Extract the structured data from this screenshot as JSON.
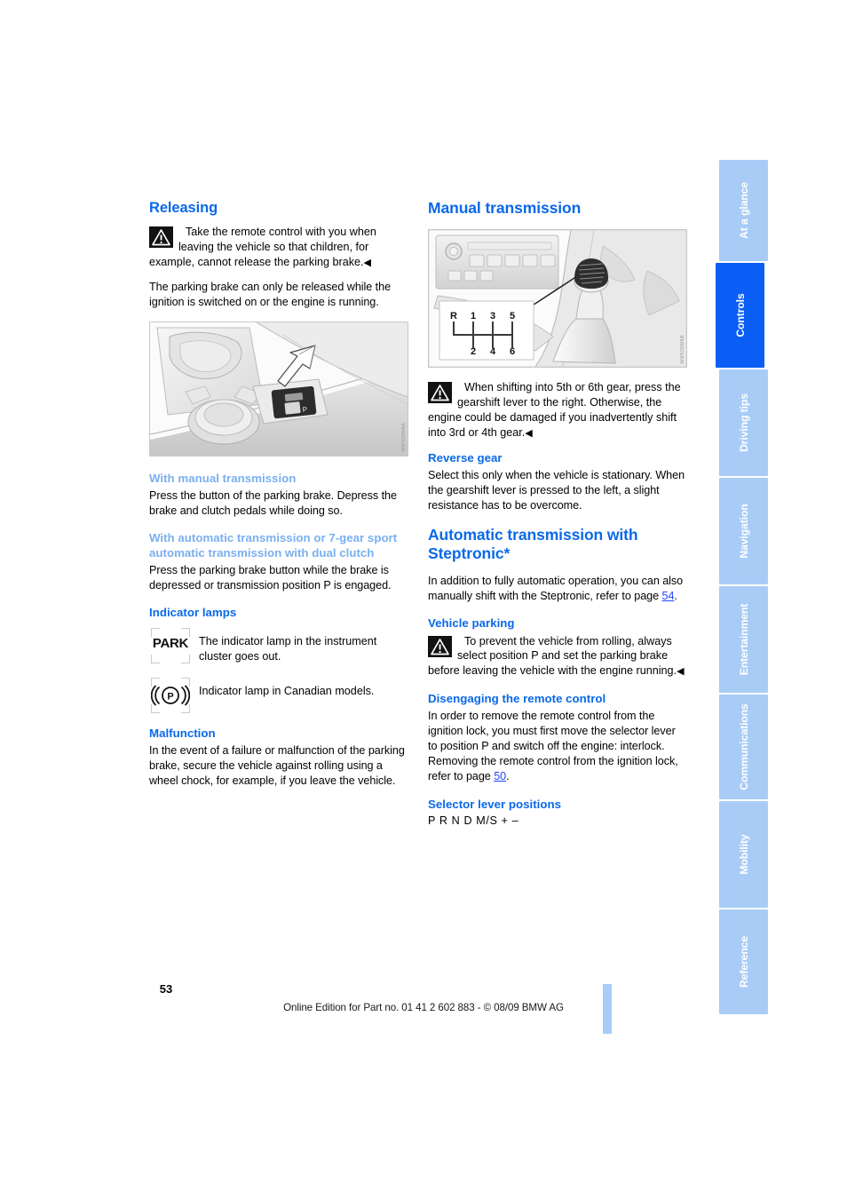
{
  "left_column": {
    "releasing": {
      "heading": "Releasing",
      "warning": "Take the remote control with you when leaving the vehicle so that children, for example, cannot release the parking brake.",
      "body": "The parking brake can only be released while the ignition is switched on or the engine is running."
    },
    "figure_console": {
      "code": "WW52DMAA"
    },
    "with_manual": {
      "heading": "With manual transmission",
      "body": "Press the button of the parking brake. Depress the brake and clutch pedals while doing so."
    },
    "with_automatic": {
      "heading": "With automatic transmission or 7-gear sport automatic transmission with dual clutch",
      "body": "Press the parking brake button while the brake is depressed or transmission position P is engaged."
    },
    "indicator_lamps": {
      "heading": "Indicator lamps",
      "items": [
        {
          "icon": "park-lamp-icon",
          "icon_label": "PARK",
          "text": "The indicator lamp in the instrument cluster goes out."
        },
        {
          "icon": "p-circle-lamp-icon",
          "icon_label": "((P))",
          "text": "Indicator lamp in Canadian models."
        }
      ]
    },
    "malfunction": {
      "heading": "Malfunction",
      "body": "In the event of a failure or malfunction of the parking brake, secure the vehicle against rolling using a wheel chock, for example, if you leave the vehicle."
    }
  },
  "right_column": {
    "manual_transmission": {
      "heading": "Manual transmission",
      "figure": {
        "code": "WW52DMAB",
        "shift_pattern": {
          "top_labels": [
            "R",
            "1",
            "3",
            "5"
          ],
          "bottom_labels": [
            "2",
            "4",
            "6"
          ]
        }
      },
      "warning": "When shifting into 5th or 6th gear, press the gearshift lever to the right. Otherwise, the engine could be damaged if you inadvertently shift into 3rd or 4th gear."
    },
    "reverse_gear": {
      "heading": "Reverse gear",
      "body": "Select this only when the vehicle is stationary. When the gearshift lever is pressed to the left, a slight resistance has to be overcome."
    },
    "automatic_steptronic": {
      "heading": "Automatic transmission with Steptronic*",
      "body_before": "In addition to fully automatic operation, you can also manually shift with the Steptronic, refer to page ",
      "page_ref": "54",
      "body_after": "."
    },
    "vehicle_parking": {
      "heading": "Vehicle parking",
      "warning": "To prevent the vehicle from rolling, always select position P and set the parking brake before leaving the vehicle with the engine running."
    },
    "disengaging": {
      "heading": "Disengaging the remote control",
      "body_before": "In order to remove the remote control from the ignition lock, you must first move the selector lever to position P and switch off the engine: interlock. Removing the remote control from the ignition lock, refer to page ",
      "page_ref": "50",
      "body_after": "."
    },
    "selector_lever": {
      "heading": "Selector lever positions",
      "positions": "P R N D M/S + –"
    }
  },
  "sidebar": {
    "tabs": [
      {
        "label": "At a glance",
        "active": false
      },
      {
        "label": "Controls",
        "active": true
      },
      {
        "label": "Driving tips",
        "active": false
      },
      {
        "label": "Navigation",
        "active": false
      },
      {
        "label": "Entertainment",
        "active": false
      },
      {
        "label": "Communications",
        "active": false
      },
      {
        "label": "Mobility",
        "active": false
      },
      {
        "label": "Reference",
        "active": false
      }
    ]
  },
  "footer": {
    "page_number": "53",
    "imprint": "Online Edition for Part no. 01 41 2 602 883 - © 08/09 BMW AG"
  },
  "colors": {
    "heading_blue": "#0a69e8",
    "subheading_blue": "#7ab0ef",
    "link_blue": "#2346ff",
    "tab_inactive": "#a9ccf7",
    "tab_active": "#0a5ef5"
  }
}
